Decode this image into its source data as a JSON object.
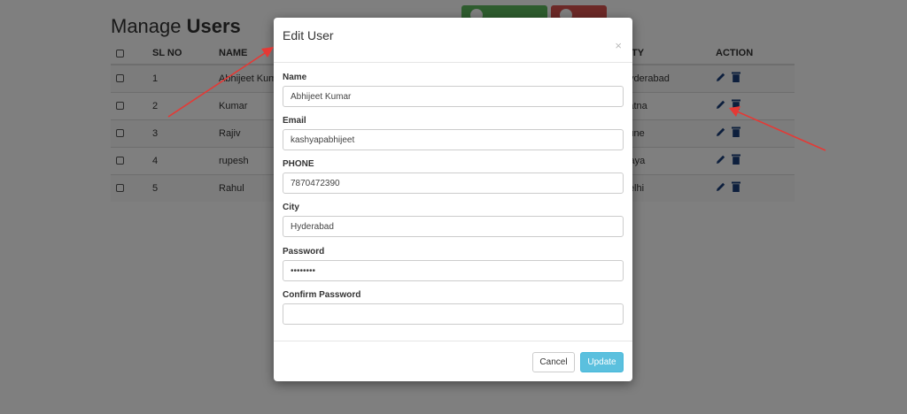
{
  "page": {
    "title_normal": "Manage ",
    "title_bold": "Users"
  },
  "table": {
    "headers": [
      "SL NO",
      "NAME",
      "CITY",
      "ACTION"
    ],
    "rows": [
      {
        "sl": "1",
        "name": "Abhijeet Kumar",
        "city": "Hyderabad"
      },
      {
        "sl": "2",
        "name": "Kumar",
        "city": "Patna"
      },
      {
        "sl": "3",
        "name": "Rajiv",
        "city": "Pune"
      },
      {
        "sl": "4",
        "name": "rupesh",
        "city": "Gaya"
      },
      {
        "sl": "5",
        "name": "Rahul",
        "city": "Delhi"
      }
    ]
  },
  "modal": {
    "title": "Edit User",
    "close_symbol": "×",
    "fields": {
      "name": {
        "label": "Name",
        "value": "Abhijeet Kumar"
      },
      "email": {
        "label": "Email",
        "value": "kashyapabhijeet"
      },
      "phone": {
        "label": "PHONE",
        "value": "7870472390"
      },
      "city": {
        "label": "City",
        "value": "Hyderabad"
      },
      "password": {
        "label": "Password",
        "value": "********"
      },
      "confirm_password": {
        "label": "Confirm Password",
        "value": ""
      }
    },
    "cancel_label": "Cancel",
    "update_label": "Update"
  },
  "colors": {
    "add_button": "#5cb85c",
    "delete_button": "#d9534f",
    "update_button": "#5bc0de",
    "action_icons": "#1a3e7a",
    "annotation_arrow": "#e53935"
  },
  "icons": {
    "action_edit": "pencil-icon",
    "action_delete": "trash-icon"
  }
}
